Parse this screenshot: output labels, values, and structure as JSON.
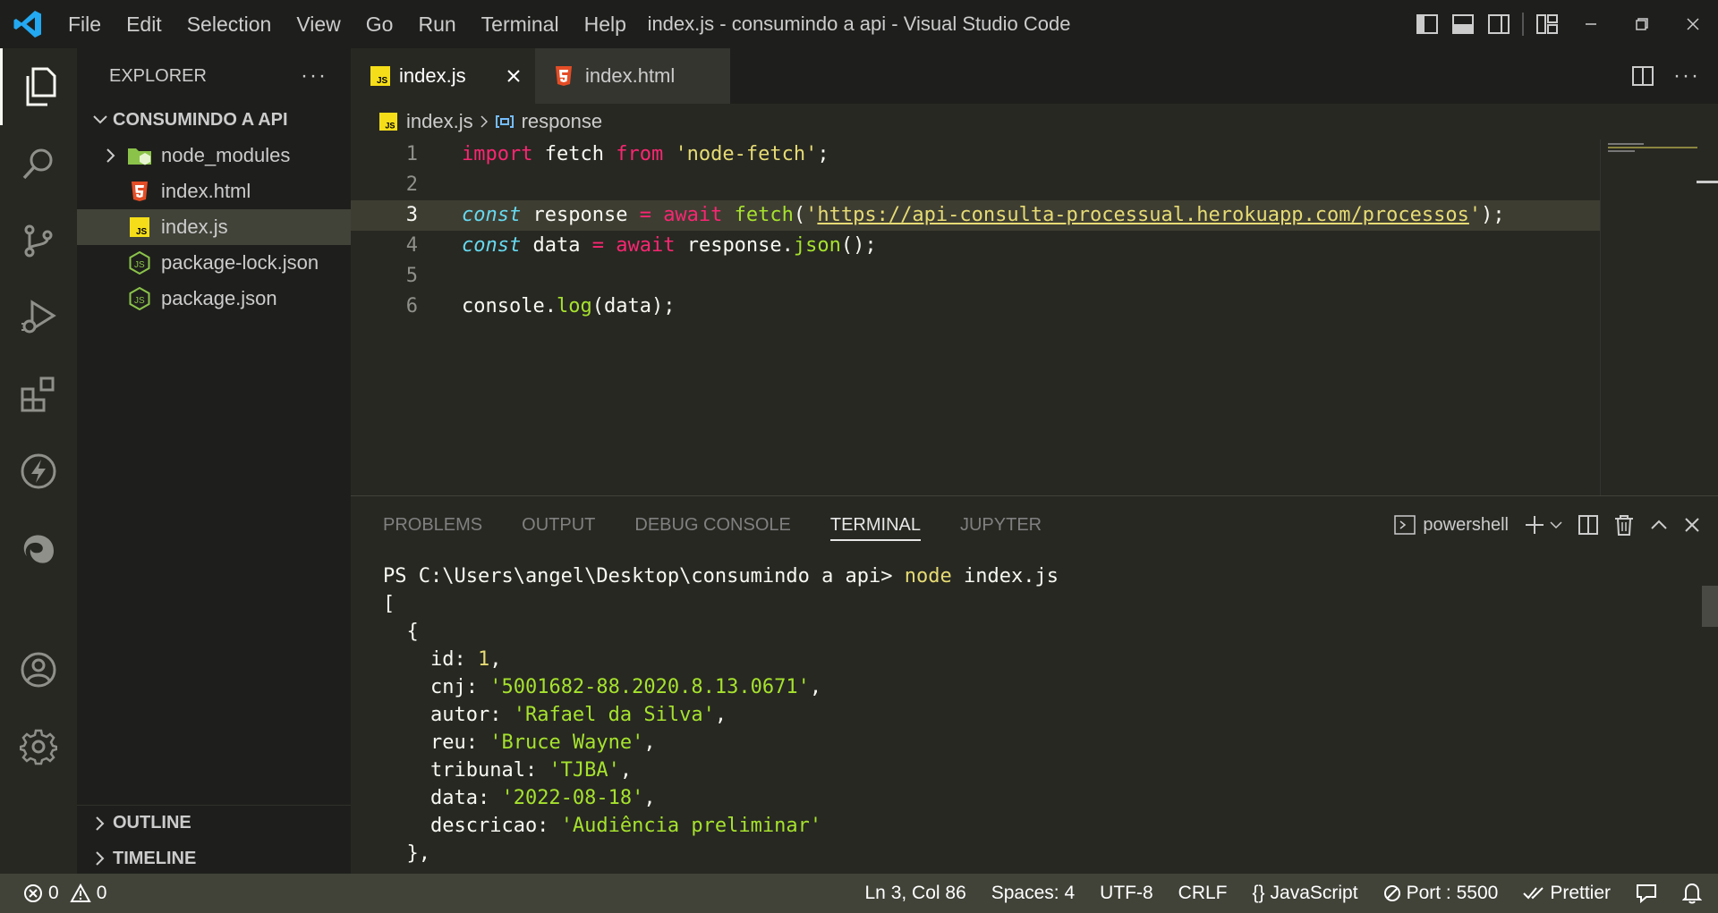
{
  "app": {
    "window_title": "index.js - consumindo a api - Visual Studio Code",
    "menu": [
      "File",
      "Edit",
      "Selection",
      "View",
      "Go",
      "Run",
      "Terminal",
      "Help"
    ]
  },
  "sidebar": {
    "title": "EXPLORER",
    "folder": "CONSUMINDO A API",
    "files": [
      {
        "name": "node_modules",
        "icon": "folder-node-icon",
        "type": "folder"
      },
      {
        "name": "index.html",
        "icon": "html5-icon",
        "type": "file"
      },
      {
        "name": "index.js",
        "icon": "js-icon",
        "type": "file",
        "selected": true
      },
      {
        "name": "package-lock.json",
        "icon": "nodejs-icon",
        "type": "file"
      },
      {
        "name": "package.json",
        "icon": "nodejs-icon",
        "type": "file"
      }
    ],
    "outline": "OUTLINE",
    "timeline": "TIMELINE"
  },
  "tabs": [
    {
      "label": "index.js",
      "active": true
    },
    {
      "label": "index.html",
      "active": false
    }
  ],
  "breadcrumb": {
    "file": "index.js",
    "symbol": "response"
  },
  "editor": {
    "line_numbers": [
      "1",
      "2",
      "3",
      "4",
      "5",
      "6"
    ],
    "l1": {
      "import": "import",
      "id": " fetch ",
      "from": "from",
      "sp": " ",
      "str": "'node-fetch'",
      "end": ";"
    },
    "l3": {
      "const": "const",
      "id": " response ",
      "eq": "=",
      "sp1": " ",
      "await": "await",
      "sp2": " ",
      "fn": "fetch",
      "open": "(",
      "q1": "'",
      "url": "https://api-consulta-processual.herokuapp.com/processos",
      "q2": "'",
      "close": ");"
    },
    "l4": {
      "const": "const",
      "id": " data ",
      "eq": "=",
      "sp1": " ",
      "await": "await",
      "sp2": " ",
      "obj": "response.",
      "fn": "json",
      "close": "();"
    },
    "l6": {
      "obj": "console.",
      "fn": "log",
      "args": "(data);"
    }
  },
  "panel": {
    "tabs": [
      "PROBLEMS",
      "OUTPUT",
      "DEBUG CONSOLE",
      "TERMINAL",
      "JUPYTER"
    ],
    "active_tab": "TERMINAL",
    "shell": "powershell",
    "prompt": "PS C:\\Users\\angel\\Desktop\\consumindo a api> ",
    "command": "node",
    "command_args": " index.js",
    "output": {
      "open_bracket": "[",
      "open_brace": "  {",
      "id_key": "    id: ",
      "id_val": "1",
      "id_end": ",",
      "cnj_key": "    cnj: ",
      "cnj_val": "'5001682-88.2020.8.13.0671'",
      "cnj_end": ",",
      "autor_key": "    autor: ",
      "autor_val": "'Rafael da Silva'",
      "autor_end": ",",
      "reu_key": "    reu: ",
      "reu_val": "'Bruce Wayne'",
      "reu_end": ",",
      "tribunal_key": "    tribunal: ",
      "tribunal_val": "'TJBA'",
      "tribunal_end": ",",
      "data_key": "    data: ",
      "data_val": "'2022-08-18'",
      "data_end": ",",
      "descricao_key": "    descricao: ",
      "descricao_val": "'Audiência preliminar'",
      "close_brace": "  },"
    }
  },
  "statusbar": {
    "errors": "0",
    "warnings": "0",
    "position": "Ln 3, Col 86",
    "spaces": "Spaces: 4",
    "encoding": "UTF-8",
    "eol": "CRLF",
    "language": "JavaScript",
    "port": "Port : 5500",
    "prettier": "Prettier"
  },
  "colors": {
    "keyword": "#f92672",
    "storage": "#66d9ef",
    "string": "#e6db74",
    "function": "#a6e22e",
    "vscode_blue": "#23a9f2"
  }
}
